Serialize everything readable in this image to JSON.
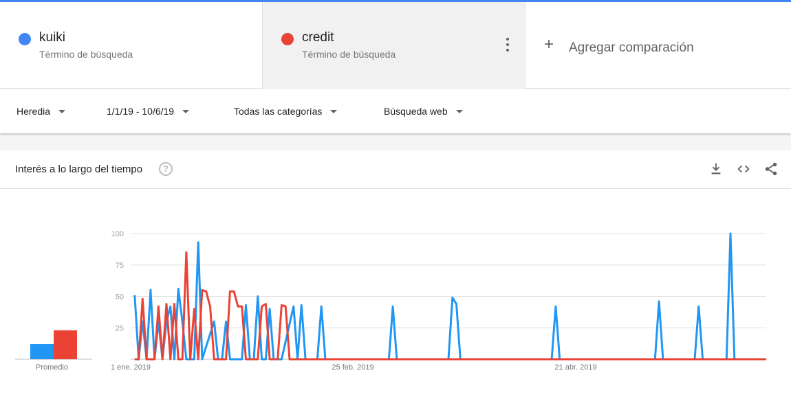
{
  "terms": [
    {
      "name": "kuiki",
      "sub": "Término de búsqueda",
      "color": "#4285f4"
    },
    {
      "name": "credit",
      "sub": "Término de búsqueda",
      "color": "#ea4335"
    }
  ],
  "add_comparison": {
    "label": "Agregar comparación",
    "icon": "plus-icon"
  },
  "filters": {
    "region": "Heredia",
    "date_range": "1/1/19 - 10/6/19",
    "category": "Todas las categorías",
    "search_type": "Búsqueda web"
  },
  "card": {
    "title": "Interés a lo largo del tiempo",
    "help_symbol": "?",
    "actions": [
      "download-icon",
      "embed-icon",
      "share-icon"
    ]
  },
  "chart_data": {
    "type": "line",
    "x_count": 161,
    "ylim": [
      0,
      100
    ],
    "y_ticks": [
      "100",
      "75",
      "50",
      "25"
    ],
    "x_tick_labels": [
      "1 ene. 2019",
      "25 feb. 2019",
      "21 abr. 2019"
    ],
    "average_label": "Promedio",
    "averages": [
      {
        "name": "kuiki",
        "value": 12
      },
      {
        "name": "credit",
        "value": 23
      }
    ],
    "series": [
      {
        "name": "kuiki",
        "color": "#2196f3",
        "points": [
          [
            1,
            51
          ],
          [
            2,
            0
          ],
          [
            3,
            30
          ],
          [
            4,
            0
          ],
          [
            5,
            55
          ],
          [
            6,
            0
          ],
          [
            7,
            30
          ],
          [
            8,
            0
          ],
          [
            9,
            30
          ],
          [
            10,
            42
          ],
          [
            11,
            0
          ],
          [
            12,
            56
          ],
          [
            13,
            30
          ],
          [
            14,
            0
          ],
          [
            15,
            0
          ],
          [
            16,
            0
          ],
          [
            17,
            93
          ],
          [
            18,
            0
          ],
          [
            21,
            30
          ],
          [
            22,
            0
          ],
          [
            23,
            0
          ],
          [
            24,
            30
          ],
          [
            25,
            0
          ],
          [
            26,
            0
          ],
          [
            27,
            0
          ],
          [
            28,
            0
          ],
          [
            29,
            43
          ],
          [
            30,
            0
          ],
          [
            31,
            0
          ],
          [
            32,
            50
          ],
          [
            33,
            0
          ],
          [
            34,
            0
          ],
          [
            35,
            40
          ],
          [
            36,
            0
          ],
          [
            37,
            0
          ],
          [
            38,
            0
          ],
          [
            41,
            42
          ],
          [
            42,
            0
          ],
          [
            43,
            43
          ],
          [
            44,
            0
          ],
          [
            46,
            0
          ],
          [
            47,
            0
          ],
          [
            48,
            42
          ],
          [
            49,
            0
          ],
          [
            50,
            0
          ],
          [
            51,
            0
          ],
          [
            52,
            0
          ],
          [
            53,
            0
          ],
          [
            54,
            0
          ],
          [
            55,
            0
          ],
          [
            56,
            0
          ],
          [
            58,
            0
          ],
          [
            59,
            0
          ],
          [
            60,
            0
          ],
          [
            61,
            0
          ],
          [
            62,
            0
          ],
          [
            63,
            0
          ],
          [
            64,
            0
          ],
          [
            65,
            0
          ],
          [
            66,
            42
          ],
          [
            67,
            0
          ],
          [
            68,
            0
          ],
          [
            69,
            0
          ],
          [
            70,
            0
          ],
          [
            71,
            0
          ],
          [
            72,
            0
          ],
          [
            73,
            0
          ],
          [
            74,
            0
          ],
          [
            75,
            0
          ],
          [
            76,
            0
          ],
          [
            77,
            0
          ],
          [
            78,
            0
          ],
          [
            79,
            0
          ],
          [
            80,
            0
          ],
          [
            81,
            49
          ],
          [
            82,
            44
          ],
          [
            83,
            0
          ],
          [
            84,
            0
          ],
          [
            85,
            0
          ],
          [
            87,
            0
          ],
          [
            88,
            0
          ],
          [
            89,
            0
          ],
          [
            90,
            0
          ],
          [
            91,
            0
          ],
          [
            92,
            0
          ],
          [
            93,
            0
          ],
          [
            94,
            0
          ],
          [
            95,
            0
          ],
          [
            96,
            0
          ],
          [
            97,
            0
          ],
          [
            98,
            0
          ],
          [
            99,
            0
          ],
          [
            100,
            0
          ],
          [
            101,
            0
          ],
          [
            102,
            0
          ],
          [
            103,
            0
          ],
          [
            104,
            0
          ],
          [
            105,
            0
          ],
          [
            106,
            0
          ],
          [
            107,
            42
          ],
          [
            108,
            0
          ],
          [
            109,
            0
          ],
          [
            110,
            0
          ],
          [
            111,
            0
          ],
          [
            112,
            0
          ],
          [
            113,
            0
          ],
          [
            114,
            0
          ],
          [
            115,
            0
          ],
          [
            116,
            0
          ],
          [
            117,
            0
          ],
          [
            118,
            0
          ],
          [
            119,
            0
          ],
          [
            120,
            0
          ],
          [
            121,
            0
          ],
          [
            122,
            0
          ],
          [
            123,
            0
          ],
          [
            124,
            0
          ],
          [
            125,
            0
          ],
          [
            126,
            0
          ],
          [
            127,
            0
          ],
          [
            128,
            0
          ],
          [
            129,
            0
          ],
          [
            130,
            0
          ],
          [
            131,
            0
          ],
          [
            132,
            0
          ],
          [
            133,
            46
          ],
          [
            134,
            0
          ],
          [
            135,
            0
          ],
          [
            136,
            0
          ],
          [
            137,
            0
          ],
          [
            138,
            0
          ],
          [
            139,
            0
          ],
          [
            140,
            0
          ],
          [
            141,
            0
          ],
          [
            142,
            0
          ],
          [
            143,
            42
          ],
          [
            144,
            0
          ],
          [
            145,
            0
          ],
          [
            146,
            0
          ],
          [
            147,
            0
          ],
          [
            148,
            0
          ],
          [
            149,
            0
          ],
          [
            150,
            0
          ],
          [
            151,
            100
          ],
          [
            152,
            0
          ],
          [
            153,
            0
          ],
          [
            154,
            0
          ],
          [
            155,
            0
          ],
          [
            156,
            0
          ],
          [
            157,
            0
          ],
          [
            158,
            0
          ],
          [
            159,
            0
          ],
          [
            160,
            0
          ]
        ]
      },
      {
        "name": "credit",
        "color": "#ea4335",
        "points": [
          [
            1,
            0
          ],
          [
            2,
            0
          ],
          [
            3,
            48
          ],
          [
            4,
            0
          ],
          [
            5,
            0
          ],
          [
            6,
            0
          ],
          [
            7,
            42
          ],
          [
            8,
            0
          ],
          [
            9,
            44
          ],
          [
            10,
            0
          ],
          [
            11,
            44
          ],
          [
            12,
            0
          ],
          [
            13,
            0
          ],
          [
            14,
            85
          ],
          [
            15,
            0
          ],
          [
            16,
            40
          ],
          [
            17,
            0
          ],
          [
            18,
            55
          ],
          [
            19,
            54
          ],
          [
            20,
            42
          ],
          [
            21,
            0
          ],
          [
            22,
            0
          ],
          [
            23,
            0
          ],
          [
            24,
            0
          ],
          [
            25,
            54
          ],
          [
            26,
            54
          ],
          [
            27,
            42
          ],
          [
            28,
            42
          ],
          [
            29,
            0
          ],
          [
            30,
            0
          ],
          [
            31,
            0
          ],
          [
            32,
            0
          ],
          [
            33,
            42
          ],
          [
            34,
            44
          ],
          [
            35,
            0
          ],
          [
            36,
            0
          ],
          [
            37,
            0
          ],
          [
            38,
            43
          ],
          [
            39,
            42
          ],
          [
            40,
            0
          ],
          [
            41,
            0
          ],
          [
            42,
            0
          ],
          [
            43,
            0
          ],
          [
            44,
            0
          ],
          [
            45,
            0
          ],
          [
            46,
            0
          ],
          [
            47,
            0
          ],
          [
            48,
            0
          ],
          [
            49,
            0
          ],
          [
            50,
            0
          ],
          [
            51,
            0
          ],
          [
            52,
            0
          ],
          [
            53,
            0
          ],
          [
            54,
            0
          ],
          [
            55,
            0
          ],
          [
            56,
            0
          ],
          [
            57,
            0
          ],
          [
            58,
            0
          ],
          [
            59,
            0
          ],
          [
            60,
            0
          ],
          [
            61,
            0
          ],
          [
            62,
            0
          ],
          [
            63,
            0
          ],
          [
            64,
            0
          ],
          [
            65,
            0
          ],
          [
            66,
            0
          ],
          [
            67,
            0
          ],
          [
            68,
            0
          ],
          [
            69,
            0
          ],
          [
            70,
            0
          ],
          [
            71,
            0
          ],
          [
            72,
            0
          ],
          [
            73,
            0
          ],
          [
            74,
            0
          ],
          [
            75,
            0
          ],
          [
            76,
            0
          ],
          [
            77,
            0
          ],
          [
            78,
            0
          ],
          [
            79,
            0
          ],
          [
            80,
            0
          ],
          [
            81,
            0
          ],
          [
            82,
            0
          ],
          [
            83,
            0
          ],
          [
            84,
            0
          ],
          [
            85,
            0
          ],
          [
            86,
            0
          ],
          [
            87,
            0
          ],
          [
            88,
            0
          ],
          [
            89,
            0
          ],
          [
            90,
            0
          ],
          [
            91,
            0
          ],
          [
            92,
            0
          ],
          [
            93,
            0
          ],
          [
            94,
            0
          ],
          [
            95,
            0
          ],
          [
            96,
            0
          ],
          [
            97,
            0
          ],
          [
            98,
            0
          ],
          [
            99,
            0
          ],
          [
            100,
            0
          ],
          [
            101,
            0
          ],
          [
            102,
            0
          ],
          [
            103,
            0
          ],
          [
            104,
            0
          ],
          [
            105,
            0
          ],
          [
            106,
            0
          ],
          [
            107,
            0
          ],
          [
            108,
            0
          ],
          [
            109,
            0
          ],
          [
            110,
            0
          ],
          [
            111,
            0
          ],
          [
            112,
            0
          ],
          [
            113,
            0
          ],
          [
            114,
            0
          ],
          [
            115,
            0
          ],
          [
            116,
            0
          ],
          [
            117,
            0
          ],
          [
            118,
            0
          ],
          [
            119,
            0
          ],
          [
            120,
            0
          ],
          [
            121,
            0
          ],
          [
            122,
            0
          ],
          [
            123,
            0
          ],
          [
            124,
            0
          ],
          [
            125,
            0
          ],
          [
            126,
            0
          ],
          [
            127,
            0
          ],
          [
            128,
            0
          ],
          [
            129,
            0
          ],
          [
            130,
            0
          ],
          [
            131,
            0
          ],
          [
            132,
            0
          ],
          [
            133,
            0
          ],
          [
            134,
            0
          ],
          [
            135,
            0
          ],
          [
            136,
            0
          ],
          [
            137,
            0
          ],
          [
            138,
            0
          ],
          [
            139,
            0
          ],
          [
            140,
            0
          ],
          [
            141,
            0
          ],
          [
            142,
            0
          ],
          [
            143,
            0
          ],
          [
            144,
            0
          ],
          [
            145,
            0
          ],
          [
            146,
            0
          ],
          [
            147,
            0
          ],
          [
            148,
            0
          ],
          [
            149,
            0
          ],
          [
            150,
            0
          ],
          [
            151,
            0
          ],
          [
            152,
            0
          ],
          [
            153,
            0
          ],
          [
            154,
            0
          ],
          [
            155,
            0
          ],
          [
            156,
            0
          ],
          [
            157,
            0
          ],
          [
            158,
            0
          ],
          [
            159,
            0
          ],
          [
            160,
            0
          ]
        ]
      }
    ]
  }
}
